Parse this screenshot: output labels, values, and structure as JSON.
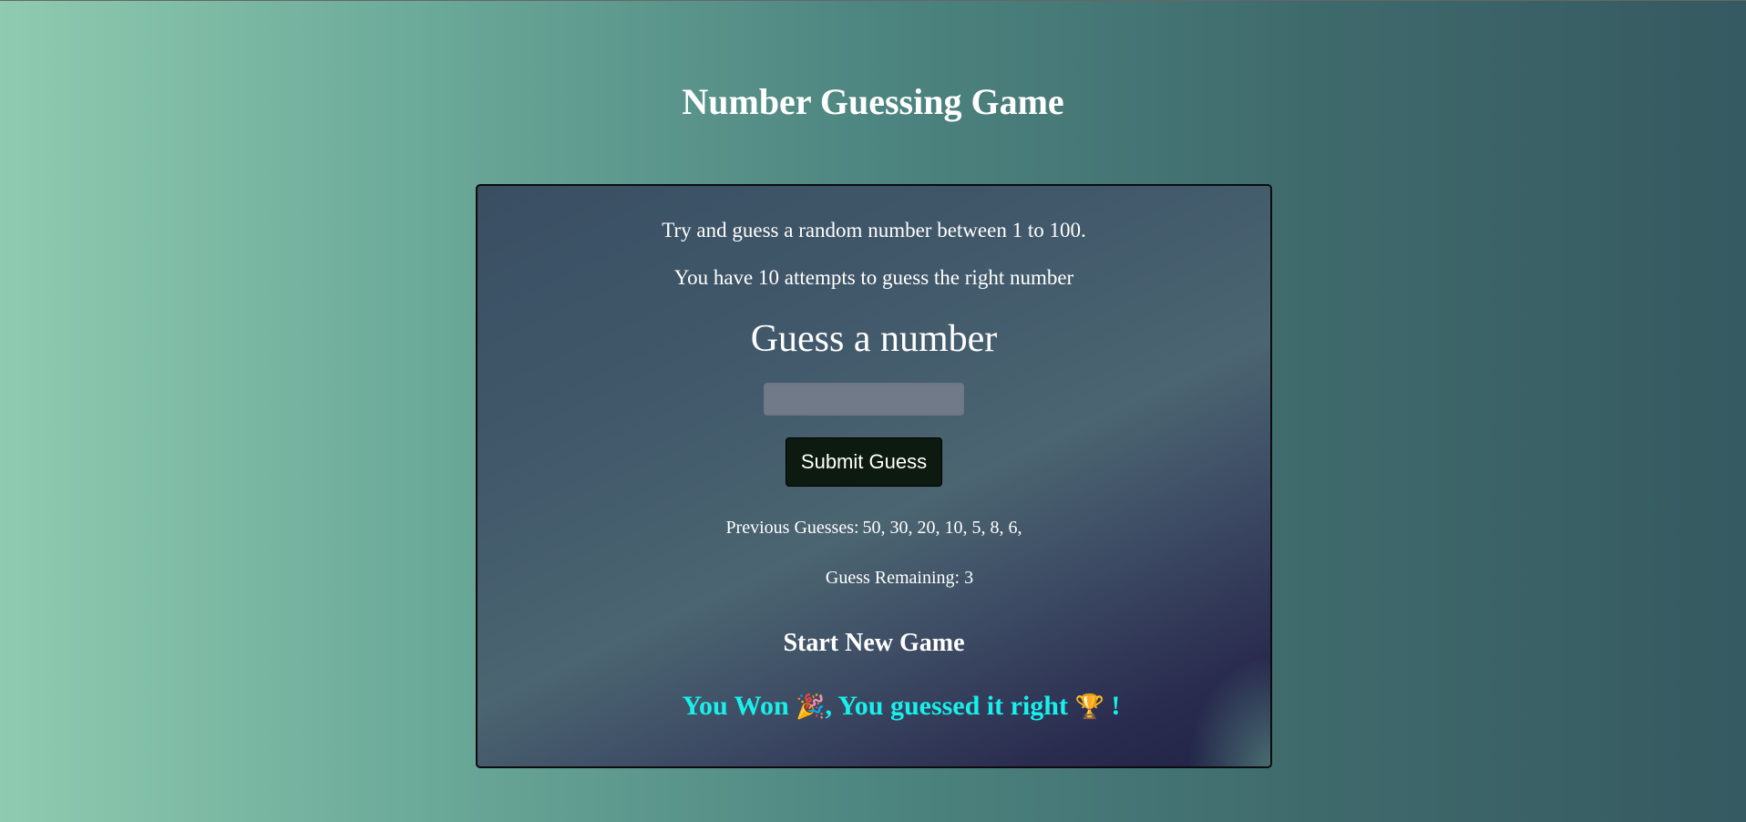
{
  "header": {
    "title": "Number Guessing Game"
  },
  "game": {
    "intro_line_1": "Try and guess a random number between 1 to 100.",
    "intro_line_2": "You have 10 attempts to guess the right number",
    "guess_heading": "Guess a number",
    "input_value": "",
    "submit_label": "Submit Guess",
    "previous_guesses_label": "Previous Guesses:",
    "previous_guesses_values": "50, 30, 20, 10, 5, 8, 6,",
    "remaining_label": "Guess Remaining:",
    "remaining_value": "3",
    "new_game_label": "Start New Game",
    "result": {
      "part_1": "You Won",
      "party_emoji": "🎉",
      "part_2": ", You guessed it right",
      "trophy_emoji": "🏆",
      "part_3": "!"
    }
  },
  "colors": {
    "result_text": "#18f0ec",
    "button_bg": "#0d1a0f"
  }
}
